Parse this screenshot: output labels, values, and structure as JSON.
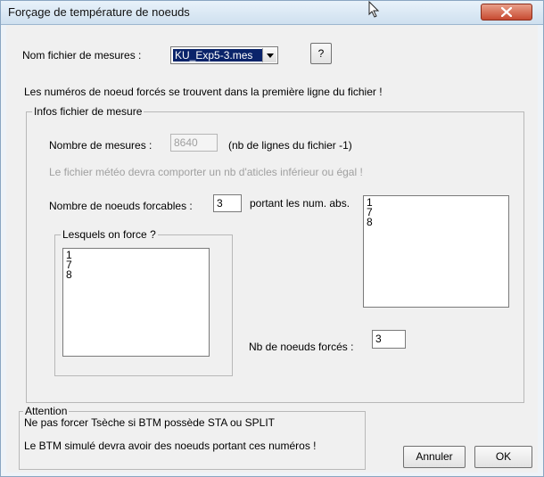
{
  "window": {
    "title": "Forçage de température de noeuds"
  },
  "file": {
    "label": "Nom fichier de mesures :",
    "selected": "KU_Exp5-3.mes",
    "help_label": "?"
  },
  "info_line": "Les numéros de noeud forcés se trouvent dans la première ligne du fichier !",
  "infos_group": {
    "title": "Infos fichier de mesure",
    "nb_mesures_label": "Nombre de mesures :",
    "nb_mesures_value": "8640",
    "nb_mesures_note": "(nb de lignes du fichier -1)",
    "meteo_note": "Le fichier météo devra comporter un nb d'aticles inférieur ou égal !",
    "forcables_label": "Nombre de noeuds forcables :",
    "forcables_value": "3",
    "portant_label": "portant les num. abs.",
    "abs_numbers": [
      "1",
      "7",
      "8"
    ],
    "lesquels_title": "Lesquels on force ?",
    "lesquels_items": [
      "1",
      "7",
      "8"
    ],
    "nb_forces_label": "Nb de noeuds forcés :",
    "nb_forces_value": "3"
  },
  "attention": {
    "title": "Attention",
    "line1": "Ne pas forcer Tsèche si BTM possède STA ou SPLIT",
    "line2": "Le BTM simulé devra avoir des noeuds portant ces numéros !"
  },
  "buttons": {
    "cancel": "Annuler",
    "ok": "OK"
  },
  "colors": {
    "selection": "#0a246a",
    "close_button": "#c74a31"
  },
  "icons": {
    "close": "close-icon",
    "cursor": "cursor-icon",
    "dropdown": "chevron-down-icon"
  }
}
